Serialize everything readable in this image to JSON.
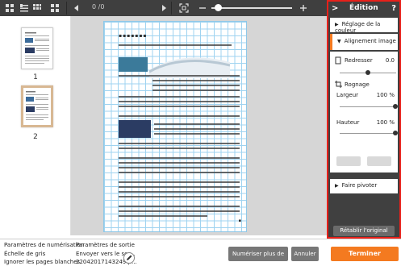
{
  "toolbar": {
    "page_counter": "0 /0",
    "icons": [
      "grid-view-icon",
      "list-view-icon",
      "grid-view-icon",
      "grid-view-icon",
      "prev-page-icon",
      "next-page-icon",
      "fit-page-icon",
      "zoom-out-icon",
      "zoom-in-icon"
    ]
  },
  "thumbnails": [
    {
      "number": "1",
      "selected": false
    },
    {
      "number": "2",
      "selected": true
    }
  ],
  "edit_panel": {
    "title": "Édition",
    "help": "?",
    "sections": {
      "color": "Réglage de la couleur",
      "alignment": "Alignement image",
      "rotate": "Faire pivoter"
    },
    "straighten_label": "Redresser",
    "straighten_value": "0.0",
    "crop_label": "Rognage",
    "width_label": "Largeur",
    "width_value": "100 %",
    "height_label": "Hauteur",
    "height_value": "100 %",
    "reset_label": "Rétablir l'original"
  },
  "bottom": {
    "scan_settings_title": "Paramètres de numérisation",
    "scan_setting_1": "Échelle de gris",
    "scan_setting_2": "Ignorer les pages blanches",
    "output_title": "Paramètres de sortie",
    "output_1": "Envoyer vers le ser...",
    "output_2": "22042017143249.p...",
    "scan_more": "Numériser plus de pages",
    "cancel": "Annuler",
    "finish": "Terminer"
  },
  "colors": {
    "accent_orange": "#f47a20",
    "highlight_red": "#e8201a",
    "toolbar_dark": "#3f3f3f",
    "grid_blue": "#9fd3f0"
  }
}
